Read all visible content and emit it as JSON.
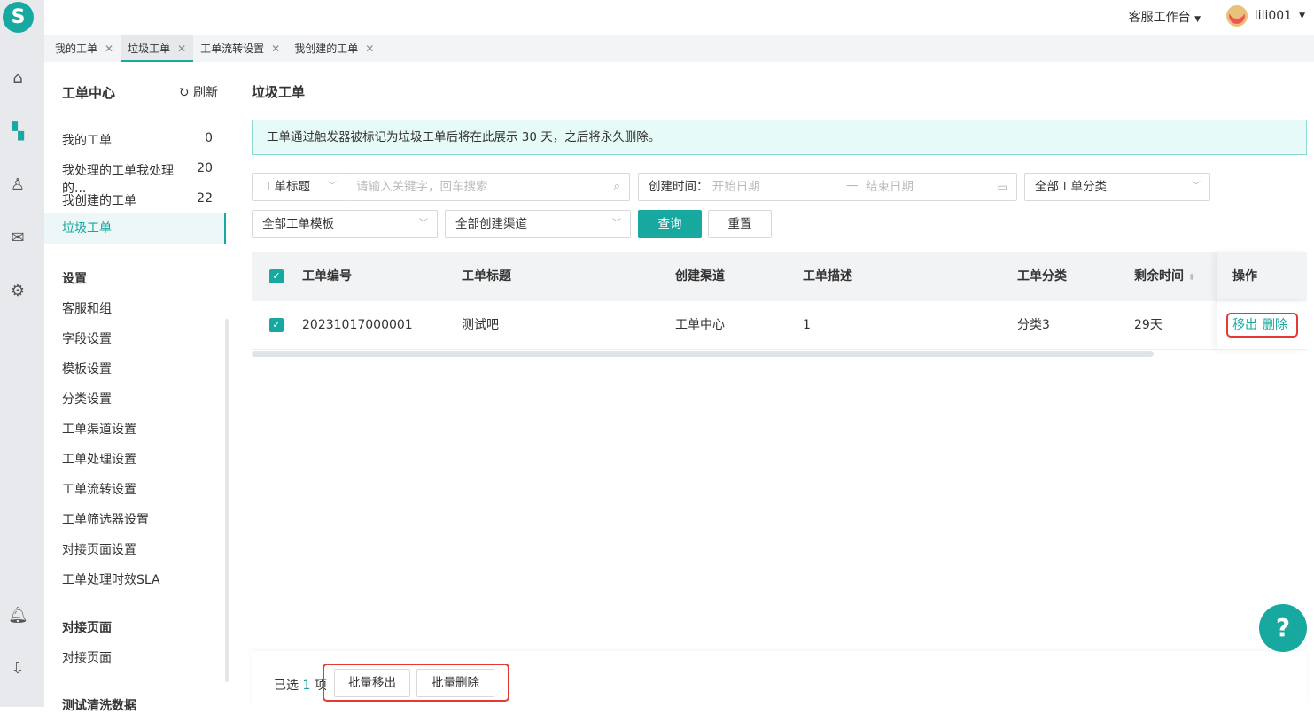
{
  "topbar": {
    "workspace": "客服工作台",
    "username": "lili001"
  },
  "tabs": [
    {
      "label": "我的工单"
    },
    {
      "label": "垃圾工单",
      "active": true
    },
    {
      "label": "工单流转设置"
    },
    {
      "label": "我创建的工单"
    }
  ],
  "sidebar": {
    "title": "工单中心",
    "refresh": "刷新",
    "items": [
      {
        "label": "我的工单",
        "count": "0"
      },
      {
        "label": "我处理的工单我处理的...",
        "count": "20"
      },
      {
        "label": "我创建的工单",
        "count": "22"
      },
      {
        "label": "垃圾工单",
        "count": ""
      }
    ],
    "settings_title": "设置",
    "settings": [
      "客服和组",
      "字段设置",
      "模板设置",
      "分类设置",
      "工单渠道设置",
      "工单处理设置",
      "工单流转设置",
      "工单筛选器设置",
      "对接页面设置",
      "工单处理时效SLA"
    ],
    "dock_title": "对接页面",
    "dock": [
      "对接页面"
    ],
    "clean_title": "测试清洗数据"
  },
  "main": {
    "title": "垃圾工单",
    "alert": "工单通过触发器被标记为垃圾工单后将在此展示 30 天，之后将永久删除。",
    "filters": {
      "field": "工单标题",
      "search_placeholder": "请输入关键字，回车搜索",
      "time_label": "创建时间：",
      "start_placeholder": "开始日期",
      "sep": "一",
      "end_placeholder": "结束日期",
      "category": "全部工单分类",
      "template": "全部工单模板",
      "channel": "全部创建渠道",
      "query": "查询",
      "reset": "重置"
    },
    "table": {
      "headers": [
        "工单编号",
        "工单标题",
        "创建渠道",
        "工单描述",
        "工单分类",
        "剩余时间",
        "操作"
      ],
      "rows": [
        {
          "id": "20231017000001",
          "title": "测试吧",
          "channel": "工单中心",
          "desc": "1",
          "category": "分类3",
          "remaining": "29天",
          "move": "移出",
          "delete": "删除"
        }
      ]
    },
    "footer": {
      "selected_prefix": "已选",
      "selected_count": "1",
      "selected_suffix": "项",
      "batch_move": "批量移出",
      "batch_delete": "批量删除"
    }
  },
  "colors": {
    "accent": "#17a8a0",
    "highlight": "#e53935"
  }
}
